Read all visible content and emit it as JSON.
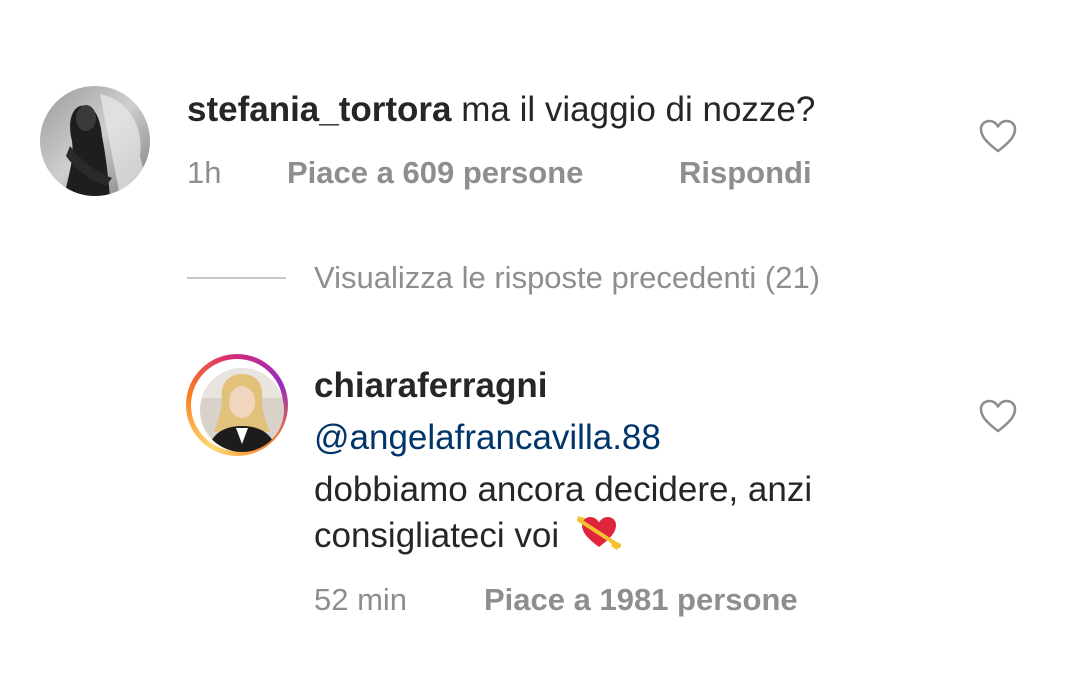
{
  "comments": [
    {
      "username": "stefania_tortora",
      "text": "ma il viaggio di nozze?",
      "time": "1h",
      "likes": "Piace a 609 persone",
      "reply_label": "Rispondi",
      "avatar_icon": "profile-photo-bw-woman"
    },
    {
      "username": "chiaraferragni",
      "mention": "@angelafrancavilla.88",
      "text_line1": "dobbiamo ancora decidere, anzi",
      "text_line2": "consigliateci voi",
      "emoji": "heart-with-arrow-emoji",
      "time": "52 min",
      "likes": "Piace a 1981 persone",
      "avatar_icon": "profile-photo-blonde-woman-story-ring"
    }
  ],
  "view_replies": "Visualizza le risposte precedenti (21)",
  "like_icon": "heart-outline-icon",
  "colors": {
    "username": "#262626",
    "meta": "#8e8e8e",
    "mention": "#003569",
    "divider": "#c7c7c7"
  }
}
